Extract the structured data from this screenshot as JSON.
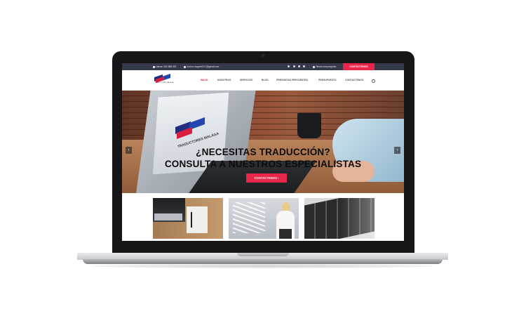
{
  "topbar": {
    "phone": "Llamar: 260 888 000",
    "email": "Correo: support24-7@gmail.com",
    "social_icons": [
      "twitter-icon",
      "facebook-icon",
      "instagram-icon",
      "rss-icon"
    ],
    "question": "Tienes una pregunta",
    "cta": "CONTÁCTENOS",
    "bg_color": "#343a48",
    "accent_color": "#e8264a"
  },
  "nav": {
    "logo_text": "TRADUCTORES MALAGA",
    "links": [
      "INICIO",
      "NOSOTROS",
      "SERVICIOS",
      "BLOG",
      "PREGUNTAS FRECUENTES",
      "PRESUPUESTO",
      "CONTÁCTENOS"
    ],
    "active_index": 0
  },
  "hero": {
    "line1": "¿NECESITAS TRADUCCIÓN?",
    "line2": "CONSULTA A NUESTROS ESPECIALISTAS",
    "button": "CONTÁCTENOS",
    "arrow_prev": "‹",
    "arrow_next": "›",
    "screen_logo_text": "TRADUCTORES MALAGA"
  },
  "thumbnails": [
    "laptop-and-notebook",
    "woman-with-words",
    "keyboard-closeup"
  ]
}
